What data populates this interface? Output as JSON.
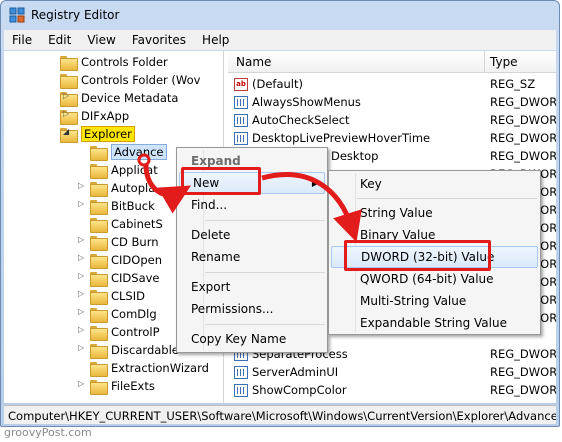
{
  "window": {
    "title": "Registry Editor"
  },
  "menubar": [
    "File",
    "Edit",
    "View",
    "Favorites",
    "Help"
  ],
  "tree": {
    "items": [
      {
        "label": "Controls Folder",
        "expanded": false,
        "has_children": false,
        "level": 1
      },
      {
        "label": "Controls Folder (Wov",
        "expanded": false,
        "has_children": false,
        "level": 1
      },
      {
        "label": "Device Metadata",
        "expanded": false,
        "has_children": true,
        "level": 1
      },
      {
        "label": "DIFxApp",
        "expanded": false,
        "has_children": true,
        "level": 1
      },
      {
        "label": "Explorer",
        "expanded": true,
        "has_children": true,
        "level": 1,
        "highlighted": true
      },
      {
        "label": "Advance",
        "expanded": false,
        "has_children": false,
        "level": 2,
        "selected": true
      },
      {
        "label": "Applicat",
        "expanded": false,
        "has_children": false,
        "level": 2
      },
      {
        "label": "Autopla",
        "expanded": false,
        "has_children": true,
        "level": 2
      },
      {
        "label": "BitBuck",
        "expanded": false,
        "has_children": true,
        "level": 2
      },
      {
        "label": "CabinetS",
        "expanded": false,
        "has_children": false,
        "level": 2
      },
      {
        "label": "CD Burn",
        "expanded": false,
        "has_children": true,
        "level": 2
      },
      {
        "label": "CIDOpen",
        "expanded": false,
        "has_children": true,
        "level": 2
      },
      {
        "label": "CIDSave",
        "expanded": false,
        "has_children": true,
        "level": 2
      },
      {
        "label": "CLSID",
        "expanded": false,
        "has_children": true,
        "level": 2
      },
      {
        "label": "ComDlg",
        "expanded": false,
        "has_children": true,
        "level": 2
      },
      {
        "label": "ControlP",
        "expanded": false,
        "has_children": true,
        "level": 2
      },
      {
        "label": "Discardable",
        "expanded": false,
        "has_children": true,
        "level": 2
      },
      {
        "label": "ExtractionWizard",
        "expanded": false,
        "has_children": false,
        "level": 2
      },
      {
        "label": "FileExts",
        "expanded": false,
        "has_children": true,
        "level": 2
      }
    ]
  },
  "values": {
    "header_name": "Name",
    "header_type": "Type",
    "rows": [
      {
        "name": "(Default)",
        "type": "REG_SZ",
        "icon": "string-value-icon"
      },
      {
        "name": "AlwaysShowMenus",
        "type": "REG_DWORD",
        "icon": "binary-value-icon"
      },
      {
        "name": "AutoCheckSelect",
        "type": "REG_DWORD",
        "icon": "binary-value-icon"
      },
      {
        "name": "DesktopLivePreviewHoverTime",
        "type": "REG_DWORD",
        "icon": "binary-value-icon"
      },
      {
        "name": "Desktop",
        "type": "REG_DWORD",
        "icon": "binary-value-icon"
      },
      {
        "name": "SeparateProcess",
        "type": "REG_DWORD",
        "icon": "binary-value-icon"
      },
      {
        "name": "ServerAdminUI",
        "type": "REG_DWORD",
        "icon": "binary-value-icon"
      },
      {
        "name": "ShowCompColor",
        "type": "REG_DWORD",
        "icon": "binary-value-icon"
      }
    ],
    "hidden_type_rows": [
      "REG_DWORD",
      "REG_DWORD",
      "REG_DWORD",
      "REG_DWORD",
      "REG_DWORD",
      "REG_DWORD",
      "REG_DWORD",
      "REG_DWORD",
      "REG_DWORD"
    ]
  },
  "context_menu": {
    "items": [
      "Expand",
      "New",
      "Find...",
      "Delete",
      "Rename",
      "Export",
      "Permissions...",
      "Copy Key Name"
    ],
    "submenu_arrow": "▶"
  },
  "submenu": {
    "items": [
      "Key",
      "String Value",
      "Binary Value",
      "DWORD (32-bit) Value",
      "QWORD (64-bit) Value",
      "Multi-String Value",
      "Expandable String Value"
    ]
  },
  "statusbar": {
    "path": "Computer\\HKEY_CURRENT_USER\\Software\\Microsoft\\Windows\\CurrentVersion\\Explorer\\Advanced"
  },
  "watermark": "groovyPost.com",
  "colors": {
    "annotation_red": "#e21b1b",
    "explorer_highlight": "#ffe600"
  }
}
